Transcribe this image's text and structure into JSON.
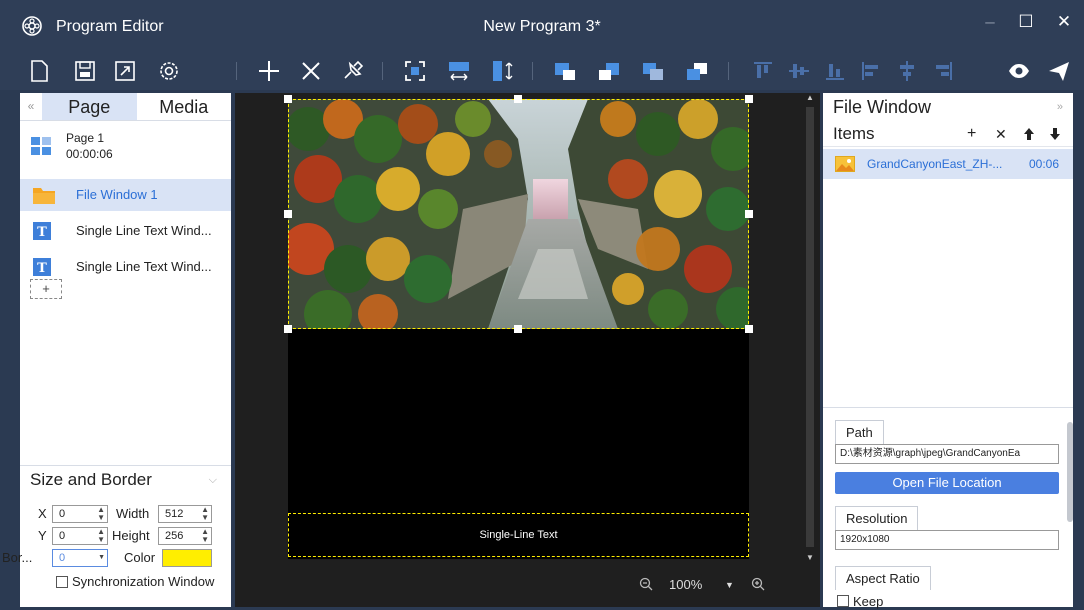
{
  "titlebar": {
    "app_title": "Program Editor",
    "doc_title": "New Program 3*",
    "minimize": "–",
    "maximize": "☐",
    "close": "✕"
  },
  "toolbar": {
    "icons": [
      "new-icon",
      "save-icon",
      "fullscreen-icon",
      "settings-icon",
      "add-icon",
      "delete-icon",
      "pin-icon",
      "fit-window-icon",
      "stretch-horizontal-icon",
      "stretch-vertical-icon",
      "bring-forward-icon",
      "send-backward-icon",
      "bring-front-icon",
      "send-back-icon",
      "align-top-icon",
      "align-vcenter-icon",
      "align-bottom-icon",
      "align-left-icon",
      "align-hcenter-icon",
      "align-right-icon",
      "preview-icon",
      "send-icon"
    ]
  },
  "left_panel": {
    "tabs": {
      "page": "Page",
      "media": "Media"
    },
    "page": {
      "name": "Page 1",
      "duration": "00:00:06"
    },
    "windows": [
      {
        "label": "File Window 1",
        "icon": "folder-icon",
        "active": true
      },
      {
        "label": "Single Line Text Wind...",
        "icon": "text-icon",
        "active": false
      },
      {
        "label": "Single Line Text Wind...",
        "icon": "text-icon",
        "active": false
      }
    ],
    "add_page": "+",
    "size_border": {
      "title": "Size and Border",
      "x_label": "X",
      "x_value": "0",
      "y_label": "Y",
      "y_value": "0",
      "width_label": "Width",
      "width_value": "512",
      "height_label": "Height",
      "height_value": "256",
      "border_label": "Bor...",
      "border_value": "0",
      "color_label": "Color",
      "color_value": "#ffee00",
      "sync_label": "Synchronization Window"
    }
  },
  "canvas": {
    "text_window": "Single-Line Text",
    "zoom": "100%"
  },
  "right_panel": {
    "title": "File Window",
    "items_label": "Items",
    "buttons": {
      "add": "+",
      "delete": "✕",
      "up": "🠕",
      "down": "🠗"
    },
    "items": [
      {
        "name": "GrandCanyonEast_ZH-...",
        "duration": "00:06"
      }
    ],
    "props": {
      "path_label": "Path",
      "path_value": "D:\\素材资源\\graph\\jpeg\\GrandCanyonEa",
      "open_location": "Open File Location",
      "resolution_label": "Resolution",
      "resolution_value": "1920x1080",
      "aspect_label": "Aspect Ratio",
      "keep_label": "Keep"
    }
  }
}
